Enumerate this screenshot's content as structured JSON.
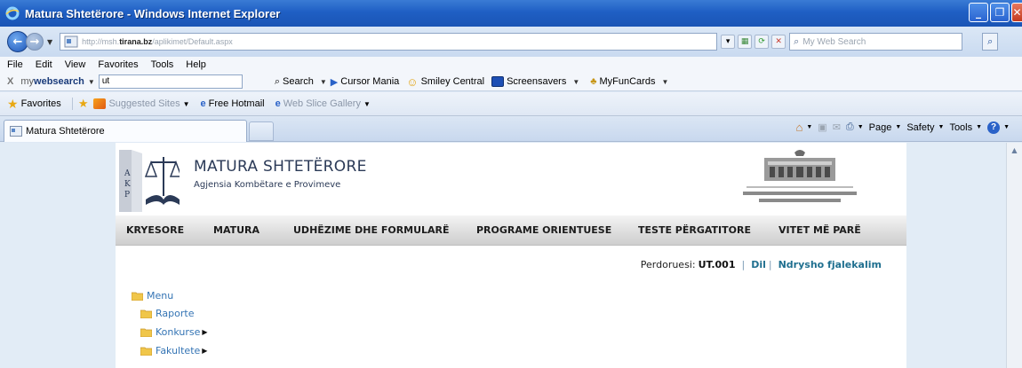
{
  "window": {
    "title": "Matura Shtetërore - Windows Internet Explorer"
  },
  "address": {
    "url_prefix": "http://msh.",
    "url_host": "tirana.bz",
    "url_path": "/aplikimet/Default.aspx",
    "search_placeholder": "My Web Search"
  },
  "menubar": {
    "items": [
      "File",
      "Edit",
      "View",
      "Favorites",
      "Tools",
      "Help"
    ]
  },
  "mws_toolbar": {
    "close": "X",
    "brand_light": "my",
    "brand_bold": "web",
    "brand_tail": "search",
    "query": "ut",
    "search_label": "Search",
    "links": [
      "Cursor Mania",
      "Smiley Central",
      "Screensavers",
      "MyFunCards"
    ]
  },
  "favorites_bar": {
    "label": "Favorites",
    "items": [
      "Suggested Sites",
      "Free Hotmail",
      "Web Slice Gallery"
    ]
  },
  "tabs": {
    "active": "Matura Shtetërore"
  },
  "command_bar": {
    "page": "Page",
    "safety": "Safety",
    "tools": "Tools"
  },
  "site": {
    "title": "MATURA SHTETËRORE",
    "subtitle": "Agjensia Kombëtare e Provimeve",
    "logo_letters": [
      "A",
      "K",
      "P"
    ],
    "nav": [
      "KRYESORE",
      "MATURA",
      "UDHËZIME DHE FORMULARË",
      "PROGRAME ORIENTUESE",
      "TESTE PËRGATITORE",
      "VITET MË PARË"
    ],
    "user_label": "Perdoruesi:",
    "user_value": "UT.001",
    "logout": "Dil",
    "change_password": "Ndrysho fjalekalim",
    "tree": {
      "root": "Menu",
      "items": [
        "Raporte",
        "Konkurse",
        "Fakultete"
      ]
    }
  },
  "colors": {
    "titlebar": "#1f5fc4",
    "nav_text": "#1c1c1c",
    "link": "#1f6f8f",
    "tree_text": "#3474b4",
    "folder": "#f0c64a"
  }
}
